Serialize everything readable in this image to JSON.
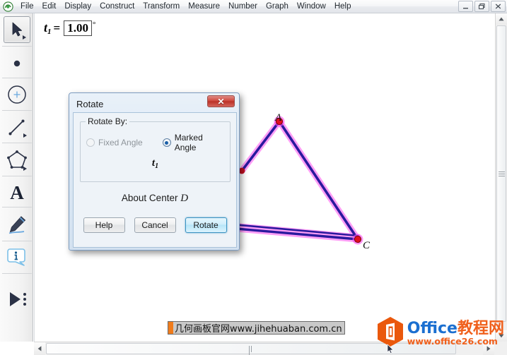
{
  "window": {
    "app_icon": "sketchpad-icon",
    "menus": [
      "File",
      "Edit",
      "Display",
      "Construct",
      "Transform",
      "Measure",
      "Number",
      "Graph",
      "Window",
      "Help"
    ],
    "controls": [
      {
        "name": "minimize-button",
        "glyph": "–"
      },
      {
        "name": "restore-button",
        "glyph": "❐"
      },
      {
        "name": "close-button",
        "glyph": "✕"
      }
    ]
  },
  "toolbox": {
    "tools": [
      {
        "name": "arrow-select-tool",
        "label": "Arrow / Select",
        "selected": true
      },
      {
        "name": "point-tool",
        "label": "Point",
        "selected": false
      },
      {
        "name": "compass-tool",
        "label": "Compass / Circle",
        "selected": false
      },
      {
        "name": "straightedge-tool",
        "label": "Straightedge / Segment",
        "selected": false
      },
      {
        "name": "polygon-tool",
        "label": "Polygon",
        "selected": false
      },
      {
        "name": "text-tool",
        "label": "Text",
        "selected": false
      },
      {
        "name": "marker-tool",
        "label": "Marker",
        "selected": false
      },
      {
        "name": "information-tool",
        "label": "Information",
        "selected": false
      },
      {
        "name": "custom-tool",
        "label": "Custom Tools",
        "selected": false
      }
    ]
  },
  "canvas": {
    "measurement": {
      "variable": "t",
      "subscript": "1",
      "equals": "=",
      "value": "1.00",
      "unit": "°"
    },
    "figure": {
      "labels": [
        {
          "name": "point-label-a",
          "text": "A"
        },
        {
          "name": "point-label-c",
          "text": "C"
        }
      ],
      "line_color": "#2a1a9e",
      "highlight_color": "#ff5ef0",
      "point_color": "#e01020"
    }
  },
  "dialog": {
    "title": "Rotate",
    "close_glyph": "✕",
    "group_label": "Rotate By:",
    "options": [
      {
        "name": "radio-fixed-angle",
        "label": "Fixed Angle",
        "checked": false
      },
      {
        "name": "radio-marked-angle",
        "label": "Marked Angle",
        "checked": true
      }
    ],
    "marked_angle_variable": "t",
    "marked_angle_subscript": "1",
    "about_center_prefix": "About Center",
    "about_center_point": "D",
    "buttons": [
      {
        "name": "help-button",
        "label": "Help",
        "default": false
      },
      {
        "name": "cancel-button",
        "label": "Cancel",
        "default": false
      },
      {
        "name": "rotate-button",
        "label": "Rotate",
        "default": true
      }
    ]
  },
  "watermarks": {
    "caption": "几何画板官网www.jihehuaban.com.cn",
    "logo_en": "Office",
    "logo_cn": "教程网",
    "logo_url": "www.office26.com"
  },
  "scrollbars": {
    "vertical": {
      "up": "▲",
      "down": "▼"
    },
    "horizontal": {
      "left": "◀",
      "right": "▶"
    }
  }
}
